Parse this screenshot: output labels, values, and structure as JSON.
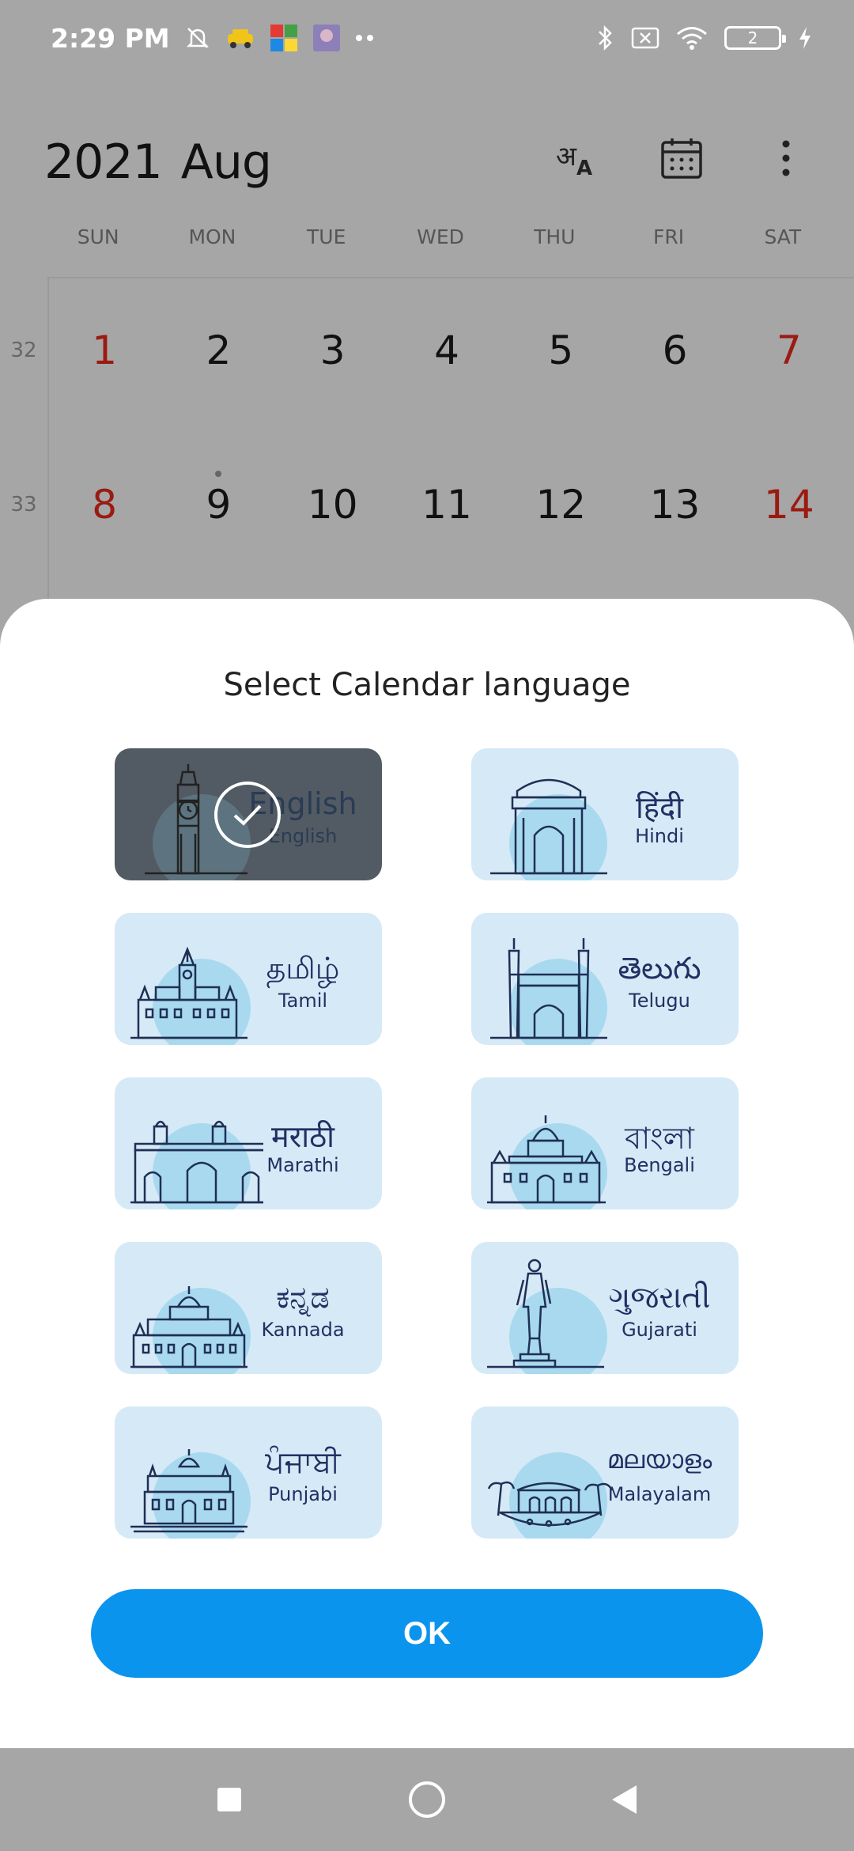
{
  "status_bar": {
    "time": "2:29 PM",
    "battery": "2",
    "icons": [
      "mute-icon",
      "taxi-app-icon",
      "ludo-app-icon",
      "photo-app-icon",
      "more-notifications-icon",
      "bluetooth-icon",
      "no-sim-icon",
      "wifi-icon",
      "battery-icon",
      "charging-icon"
    ]
  },
  "calendar": {
    "year": "2021",
    "month": "Aug",
    "actions": [
      "language-icon",
      "calendar-icon",
      "more-icon"
    ],
    "weekdays": [
      "SUN",
      "MON",
      "TUE",
      "WED",
      "THU",
      "FRI",
      "SAT"
    ],
    "weeks": [
      {
        "week_no": "32",
        "days": [
          "1",
          "2",
          "3",
          "4",
          "5",
          "6",
          "7"
        ]
      },
      {
        "week_no": "33",
        "days": [
          "8",
          "9",
          "10",
          "11",
          "12",
          "13",
          "14"
        ]
      }
    ],
    "colors": {
      "weekend": "#9b1a12",
      "text": "#111111"
    }
  },
  "dialog": {
    "title": "Select Calendar language",
    "languages": [
      {
        "native": "English",
        "english": "English",
        "icon": "big-ben-icon",
        "selected": true
      },
      {
        "native": "हिंदी",
        "english": "Hindi",
        "icon": "india-gate-icon",
        "selected": false
      },
      {
        "native": "தமிழ்",
        "english": "Tamil",
        "icon": "chennai-central-icon",
        "selected": false
      },
      {
        "native": "తెలుగు",
        "english": "Telugu",
        "icon": "charminar-icon",
        "selected": false
      },
      {
        "native": "मराठी",
        "english": "Marathi",
        "icon": "gateway-of-india-icon",
        "selected": false
      },
      {
        "native": "বাংলা",
        "english": "Bengali",
        "icon": "victoria-memorial-icon",
        "selected": false
      },
      {
        "native": "ಕನ್ನಡ",
        "english": "Kannada",
        "icon": "mysore-palace-icon",
        "selected": false
      },
      {
        "native": "ગુજરાતી",
        "english": "Gujarati",
        "icon": "statue-of-unity-icon",
        "selected": false
      },
      {
        "native": "ਪੰਜਾਬੀ",
        "english": "Punjabi",
        "icon": "golden-temple-icon",
        "selected": false
      },
      {
        "native": "മലയാളം",
        "english": "Malayalam",
        "icon": "houseboat-icon",
        "selected": false
      }
    ],
    "ok_label": "OK",
    "colors": {
      "card": "#d6e9f6",
      "accent": "#0b94ee",
      "text": "#1f3162"
    }
  },
  "nav_bar": {
    "buttons": [
      "recents-button",
      "home-button",
      "back-button"
    ]
  }
}
